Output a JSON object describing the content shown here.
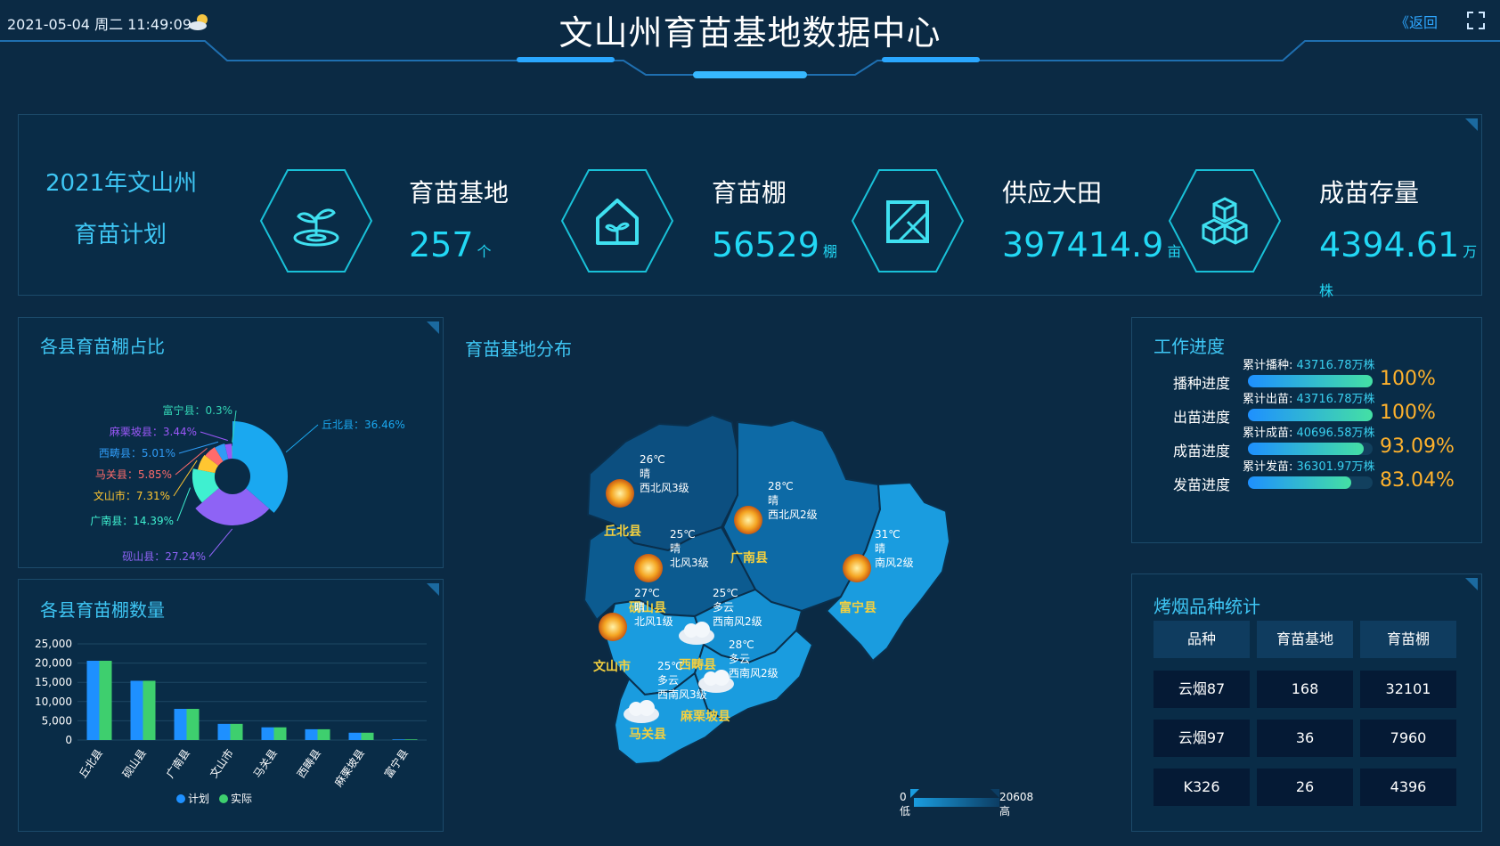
{
  "header": {
    "datetime": "2021-05-04 周二 11:49:09",
    "title": "文山州育苗基地数据中心",
    "back_label": "返回"
  },
  "plan": {
    "title_line1": "2021年文山州",
    "title_line2": "育苗计划",
    "stats": [
      {
        "label": "育苗基地",
        "value": "257",
        "unit": "个",
        "icon": "sprout-icon"
      },
      {
        "label": "育苗棚",
        "value": "56529",
        "unit": "棚",
        "icon": "greenhouse-icon"
      },
      {
        "label": "供应大田",
        "value": "397414.9",
        "unit": "亩",
        "icon": "field-icon"
      },
      {
        "label": "成苗存量",
        "value": "4394.61",
        "unit": "万株",
        "icon": "cubes-icon"
      }
    ]
  },
  "pie_panel": {
    "title": "各县育苗棚占比",
    "chart_data": {
      "type": "pie",
      "slices": [
        {
          "name": "丘北县",
          "value": 36.46,
          "label": "丘北县：36.46%",
          "color": "#1aa8f0"
        },
        {
          "name": "砚山县",
          "value": 27.24,
          "label": "砚山县：27.24%",
          "color": "#8e63f5"
        },
        {
          "name": "广南县",
          "value": 14.39,
          "label": "广南县：14.39%",
          "color": "#3ff0d0"
        },
        {
          "name": "文山市",
          "value": 7.31,
          "label": "文山市：7.31%",
          "color": "#ffc631"
        },
        {
          "name": "马关县",
          "value": 5.85,
          "label": "马关县：5.85%",
          "color": "#ff6b6b"
        },
        {
          "name": "西畴县",
          "value": 5.01,
          "label": "西畴县：5.01%",
          "color": "#2f9bf5"
        },
        {
          "name": "麻栗坡县",
          "value": 3.44,
          "label": "麻栗坡县：3.44%",
          "color": "#9a57f7"
        },
        {
          "name": "富宁县",
          "value": 0.3,
          "label": "富宁县：0.3%",
          "color": "#33d6b6"
        }
      ]
    }
  },
  "bar_panel": {
    "title": "各县育苗棚数量",
    "chart_data": {
      "type": "bar",
      "categories": [
        "丘北县",
        "砚山县",
        "广南县",
        "文山市",
        "马关县",
        "西畴县",
        "麻栗坡县",
        "富宁县"
      ],
      "series": [
        {
          "name": "计划",
          "values": [
            20600,
            15400,
            8100,
            4200,
            3300,
            2800,
            1900,
            170
          ],
          "color": "#1e90ff"
        },
        {
          "name": "实际",
          "values": [
            20600,
            15400,
            8100,
            4200,
            3300,
            2800,
            1900,
            170
          ],
          "color": "#3ecf6e"
        }
      ],
      "ylim": [
        0,
        25000
      ],
      "yticks": [
        "25,000",
        "20,000",
        "15,000",
        "10,000",
        "5,000",
        "0"
      ],
      "ytick_values": [
        25000,
        20000,
        15000,
        10000,
        5000,
        0
      ]
    }
  },
  "map_panel": {
    "title": "育苗基地分布",
    "legend_min": "0",
    "legend_max": "20608",
    "legend_low": "低",
    "legend_high": "高",
    "cities": [
      {
        "name": "丘北县",
        "temp": "26℃",
        "weather": "晴",
        "wind": "西北风3级",
        "icon": "sun-icon"
      },
      {
        "name": "广南县",
        "temp": "28℃",
        "weather": "晴",
        "wind": "西北风2级",
        "icon": "sun-icon"
      },
      {
        "name": "砚山县",
        "temp": "25℃",
        "weather": "晴",
        "wind": "北风3级",
        "icon": "sun-icon"
      },
      {
        "name": "富宁县",
        "temp": "31℃",
        "weather": "晴",
        "wind": "南风2级",
        "icon": "sun-icon"
      },
      {
        "name": "文山市",
        "temp": "27℃",
        "weather": "晴",
        "wind": "北风1级",
        "icon": "sun-icon"
      },
      {
        "name": "西畴县",
        "temp": "25℃",
        "weather": "多云",
        "wind": "西南风2级",
        "icon": "cloud-icon"
      },
      {
        "name": "麻栗坡县",
        "temp": "28℃",
        "weather": "多云",
        "wind": "西南风2级",
        "icon": "cloud-icon"
      },
      {
        "name": "马关县",
        "temp": "25℃",
        "weather": "多云",
        "wind": "西南风3级",
        "icon": "cloud-icon"
      }
    ]
  },
  "progress_panel": {
    "title": "工作进度",
    "items": [
      {
        "label": "播种进度",
        "cum_label": "累计播种: ",
        "cum_value": "43716.78万株",
        "pct": "100%",
        "fraction": 1.0
      },
      {
        "label": "出苗进度",
        "cum_label": "累计出苗: ",
        "cum_value": "43716.78万株",
        "pct": "100%",
        "fraction": 1.0
      },
      {
        "label": "成苗进度",
        "cum_label": "累计成苗: ",
        "cum_value": "40696.58万株",
        "pct": "93.09%",
        "fraction": 0.9309
      },
      {
        "label": "发苗进度",
        "cum_label": "累计发苗: ",
        "cum_value": "36301.97万株",
        "pct": "83.04%",
        "fraction": 0.8304
      }
    ]
  },
  "variety_panel": {
    "title": "烤烟品种统计",
    "headers": [
      "品种",
      "育苗基地",
      "育苗棚"
    ],
    "rows": [
      [
        "云烟87",
        "168",
        "32101"
      ],
      [
        "云烟97",
        "36",
        "7960"
      ],
      [
        "K326",
        "26",
        "4396"
      ]
    ]
  }
}
